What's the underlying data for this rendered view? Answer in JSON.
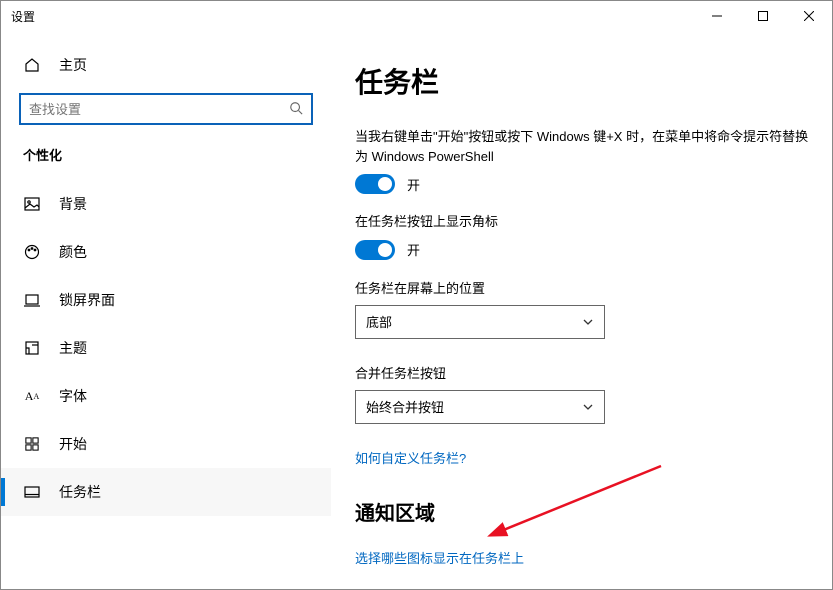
{
  "window": {
    "title": "设置"
  },
  "sidebar": {
    "home_label": "主页",
    "search_placeholder": "查找设置",
    "section": "个性化",
    "items": [
      {
        "label": "背景"
      },
      {
        "label": "颜色"
      },
      {
        "label": "锁屏界面"
      },
      {
        "label": "主题"
      },
      {
        "label": "字体"
      },
      {
        "label": "开始"
      },
      {
        "label": "任务栏"
      }
    ]
  },
  "content": {
    "title": "任务栏",
    "setting1_desc": "当我右键单击\"开始\"按钮或按下 Windows 键+X 时，在菜单中将命令提示符替换为 Windows PowerShell",
    "toggle_on": "开",
    "setting2_desc": "在任务栏按钮上显示角标",
    "position_label": "任务栏在屏幕上的位置",
    "position_value": "底部",
    "combine_label": "合并任务栏按钮",
    "combine_value": "始终合并按钮",
    "customize_link": "如何自定义任务栏?",
    "section2_title": "通知区域",
    "link_icons": "选择哪些图标显示在任务栏上"
  }
}
